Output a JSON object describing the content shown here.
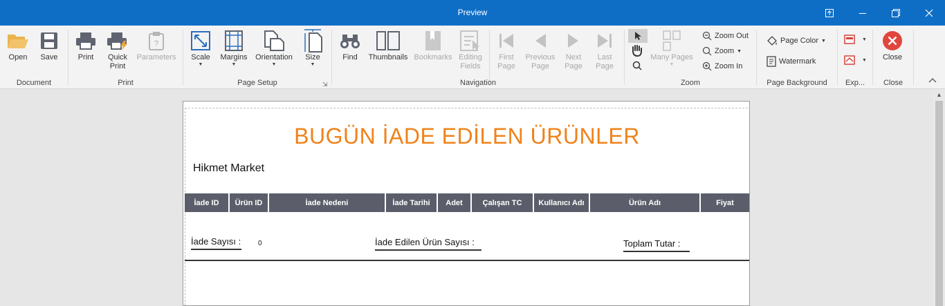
{
  "window": {
    "title": "Preview"
  },
  "ribbon": {
    "groups": {
      "document": "Document",
      "print": "Print",
      "page_setup": "Page Setup",
      "navigation": "Navigation",
      "zoom": "Zoom",
      "page_background": "Page Background",
      "export": "Exp...",
      "close": "Close"
    },
    "buttons": {
      "open": "Open",
      "save": "Save",
      "print": "Print",
      "quick_print_1": "Quick",
      "quick_print_2": "Print",
      "parameters": "Parameters",
      "scale": "Scale",
      "margins": "Margins",
      "orientation": "Orientation",
      "size": "Size",
      "find": "Find",
      "thumbnails": "Thumbnails",
      "bookmarks": "Bookmarks",
      "editing_fields_1": "Editing",
      "editing_fields_2": "Fields",
      "first_page_1": "First",
      "first_page_2": "Page",
      "previous_page_1": "Previous",
      "previous_page_2": "Page",
      "next_page_1": "Next",
      "next_page_2": "Page",
      "last_page_1": "Last",
      "last_page_2": "Page",
      "many_pages": "Many Pages",
      "zoom_out": "Zoom Out",
      "zoom": "Zoom",
      "zoom_in": "Zoom In",
      "page_color": "Page Color",
      "watermark": "Watermark",
      "close": "Close"
    }
  },
  "report": {
    "title": "BUGÜN İADE EDİLEN ÜRÜNLER",
    "company": "Hikmet Market",
    "columns": [
      "İade ID",
      "Ürün ID",
      "İade Nedeni",
      "İade Tarihi",
      "Adet",
      "Çalışan TC",
      "Kullanıcı Adı",
      "Ürün Adı",
      "Fiyat"
    ],
    "summary": {
      "return_count_label": "İade Sayısı :",
      "return_count_value": "0",
      "returned_product_count_label": "İade Edilen Ürün Sayısı :",
      "total_amount_label": "Toplam Tutar :"
    }
  },
  "colors": {
    "titlebar": "#0e6ec6",
    "report_title": "#f0821a",
    "table_header": "#5b5e6a",
    "close_button": "#e0463d"
  }
}
